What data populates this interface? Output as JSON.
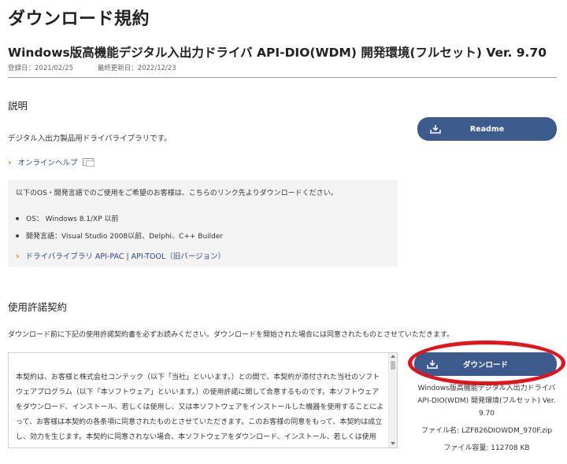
{
  "page": {
    "title": "ダウンロード規約",
    "product_title": "Windows版高機能デジタル入出力ドライバ API-DIO(WDM) 開発環境(フルセット) Ver. 9.70",
    "registered": "登録日：2021/02/25",
    "updated": "最終更新日：2022/12/23"
  },
  "description": {
    "heading": "説明",
    "text": "デジタル入出力製品用ドライバライブラリです。",
    "online_help_link": "オンラインヘルプ",
    "readme_button": "Readme"
  },
  "os_info": {
    "intro": "以下のOS・開発言語でのご使用をご希望のお客様は、こちらのリンク先よりダウンロードください。",
    "items": [
      "OS： Windows 8.1/XP 以前",
      "開発言語：Visual Studio 2008以前、Delphi、C++ Builder"
    ],
    "link": "ドライバライブラリ API-PAC | API-TOOL（旧バージョン）"
  },
  "license": {
    "heading": "使用許諾契約",
    "notice": "ダウンロード前に下記の使用許諾契約書を必ずお読みください。ダウンロードを開始された場合には同意されたものとさせていただきます。",
    "body": "本契約は、お客様と株式会社コンテック（以下「当社」といいます。）との間で、本契約が添付された当社のソフトウェアプログラム（以下「本ソフトウェア」といいます。）の使用許諾に関して合意するものです。本ソフトウェアをダウンロード、インストール、若しくは使用し、又は本ソフトウェアをインストールした機器を使用することによって、お客様は本契約の各条項に同意されたものとさせていただきます。このお客様の同意をもって、本契約は成立し、効力を生じます。本契約に同意されない場合、本ソフトウェアをダウンロード、インストール、若しくは使用し、又は本ソフトウェアをインストールした機器を使用することはできません。"
  },
  "download": {
    "button": "ダウンロード",
    "product_line1": "Windows版高機能デジタル入出力ドライバ",
    "product_line2": "API-DIO(WDM) 開発環境(フルセット) Ver.",
    "product_line3": "9.70",
    "filename": "ファイル名: LZF826DIOWDM_970F.zip",
    "filesize": "ファイル容量: 112708 KB"
  },
  "colors": {
    "button": "#3d5a8c",
    "link": "#2b4a8a",
    "chevron": "#e07a1f",
    "highlight_ellipse": "#e4131b"
  },
  "icons": [
    "download-icon",
    "chevron-right-icon",
    "window-icon"
  ]
}
